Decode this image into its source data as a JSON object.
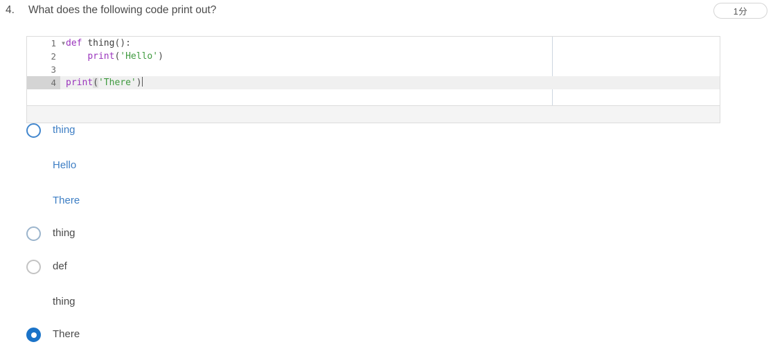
{
  "question": {
    "number": "4.",
    "text": "What does the following code print out?",
    "points_badge": "1分"
  },
  "code_editor": {
    "line_numbers": [
      "1",
      "2",
      "3",
      "4"
    ],
    "fold_arrow_icon": "triangle-down-icon",
    "active_line": "4",
    "lines": [
      {
        "num": "1",
        "kw": "def",
        "space1": " ",
        "name": "thing",
        "punct": "():"
      },
      {
        "num": "2",
        "indent": "    ",
        "fn": "print",
        "open": "(",
        "str": "'Hello'",
        "close": ")"
      },
      {
        "num": "3",
        "empty": ""
      },
      {
        "num": "4",
        "fn": "print",
        "open": "(",
        "str": "'There'",
        "close": ")"
      }
    ],
    "plain": {
      "line1": "def thing():",
      "line2": "    print('Hello')",
      "line3": "",
      "line4": "print('There')"
    }
  },
  "options": [
    {
      "id": "option-1",
      "state": "hover",
      "color": "blue",
      "lines": [
        "thing",
        "Hello",
        "There"
      ]
    },
    {
      "id": "option-2",
      "state": "muted",
      "color": "dark",
      "lines": [
        "thing"
      ]
    },
    {
      "id": "option-3",
      "state": "plain",
      "color": "dark",
      "lines": [
        "def",
        "thing"
      ]
    },
    {
      "id": "option-4",
      "state": "selected",
      "color": "dark",
      "lines": [
        "There"
      ]
    }
  ],
  "colors": {
    "accent_blue": "#1a73c8",
    "option_blue": "#3d7ec4",
    "keyword_purple": "#9a34bd",
    "string_green": "#3f9a3f",
    "text_gray": "#4a4a4a",
    "border_gray": "#dcdcdc"
  }
}
